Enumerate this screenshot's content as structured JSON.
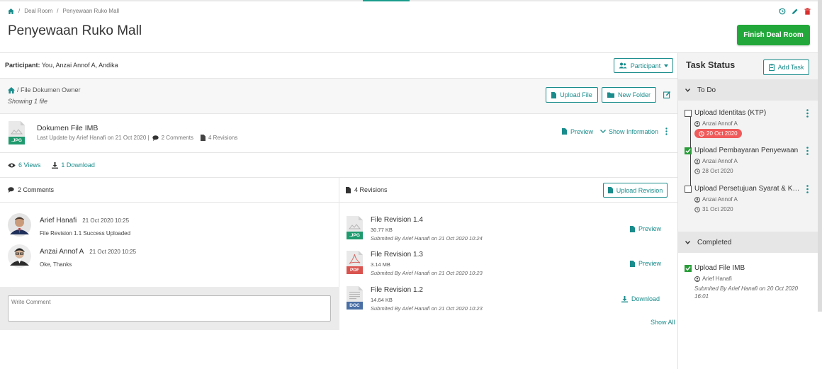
{
  "breadcrumb": {
    "sep": "/",
    "deal_room": "Deal Room",
    "current": "Penyewaan Ruko Mall"
  },
  "page_title": "Penyewaan Ruko Mall",
  "finish_button": "Finish Deal Room",
  "participant": {
    "label": "Participant:",
    "names": "You, Anzai Annof A, Andika",
    "button": "Participant"
  },
  "folder": {
    "path": "/ File Dokumen Owner",
    "count": "Showing 1 file",
    "upload_button": "Upload File",
    "new_folder_button": "New Folder"
  },
  "file": {
    "badge": ".JPG",
    "name": "Dokumen File IMB",
    "meta": "Last Update by Arief Hanafi on 21 Oct 2020 |",
    "comments": "2 Comments",
    "revisions": "4 Revisions",
    "preview": "Preview",
    "show_info": "Show Information"
  },
  "stats": {
    "views": "6 Views",
    "downloads": "1 Download"
  },
  "comments_section": {
    "header": "2 Comments",
    "items": [
      {
        "author": "Arief Hanafi",
        "time": "21 Oct 2020 10:25",
        "text": "File Revision 1.1 Success Uploaded"
      },
      {
        "author": "Anzai Annof A",
        "time": "21 Oct 2020 10:25",
        "text": "Oke, Thanks"
      }
    ],
    "placeholder": "Write Comment"
  },
  "revisions_section": {
    "header": "4 Revisions",
    "upload_button": "Upload Revision",
    "items": [
      {
        "badge": ".JPG",
        "name": "File Revision 1.4",
        "size": "30.77 KB",
        "by": "Submited By Arief Hanafi on 21 Oct 2020 10:24",
        "action": "Preview"
      },
      {
        "badge": "PDF",
        "name": "File Revision 1.3",
        "size": "3.14 MB",
        "by": "Submited By Arief Hanafi on 21 Oct 2020 10:23",
        "action": "Preview"
      },
      {
        "badge": "DOC",
        "name": "File Revision 1.2",
        "size": "14.64 KB",
        "by": "Submited By Arief Hanafi on 21 Oct 2020 10:23",
        "action": "Download"
      }
    ],
    "show_all": "Show All"
  },
  "task_status": {
    "title": "Task Status",
    "add_button": "Add Task",
    "todo_label": "To Do",
    "todo": [
      {
        "name": "Upload Identitas (KTP)",
        "assignee": "Anzai Annof A",
        "date": "20 Oct 2020",
        "overdue": true,
        "done": false
      },
      {
        "name": "Upload Pembayaran Penyewaan",
        "assignee": "Anzai Annof A",
        "date": "28 Oct 2020",
        "overdue": false,
        "done": true
      },
      {
        "name": "Upload Persetujuan Syarat & Ketentuan",
        "assignee": "Anzai Annof A",
        "date": "31 Oct 2020",
        "overdue": false,
        "done": false
      }
    ],
    "completed_label": "Completed",
    "completed": [
      {
        "name": "Upload File IMB",
        "assignee": "Arief Hanafi",
        "submitted": "Submited By Arief Hanafi on 20 Oct 2020 16:01"
      }
    ]
  },
  "colors": {
    "accent": "#1a8c8c",
    "finish": "#22a83a",
    "overdue": "#f05a5a",
    "jpg": "#1f9a6e",
    "pdf": "#d9534f",
    "doc": "#4a6fa5"
  }
}
